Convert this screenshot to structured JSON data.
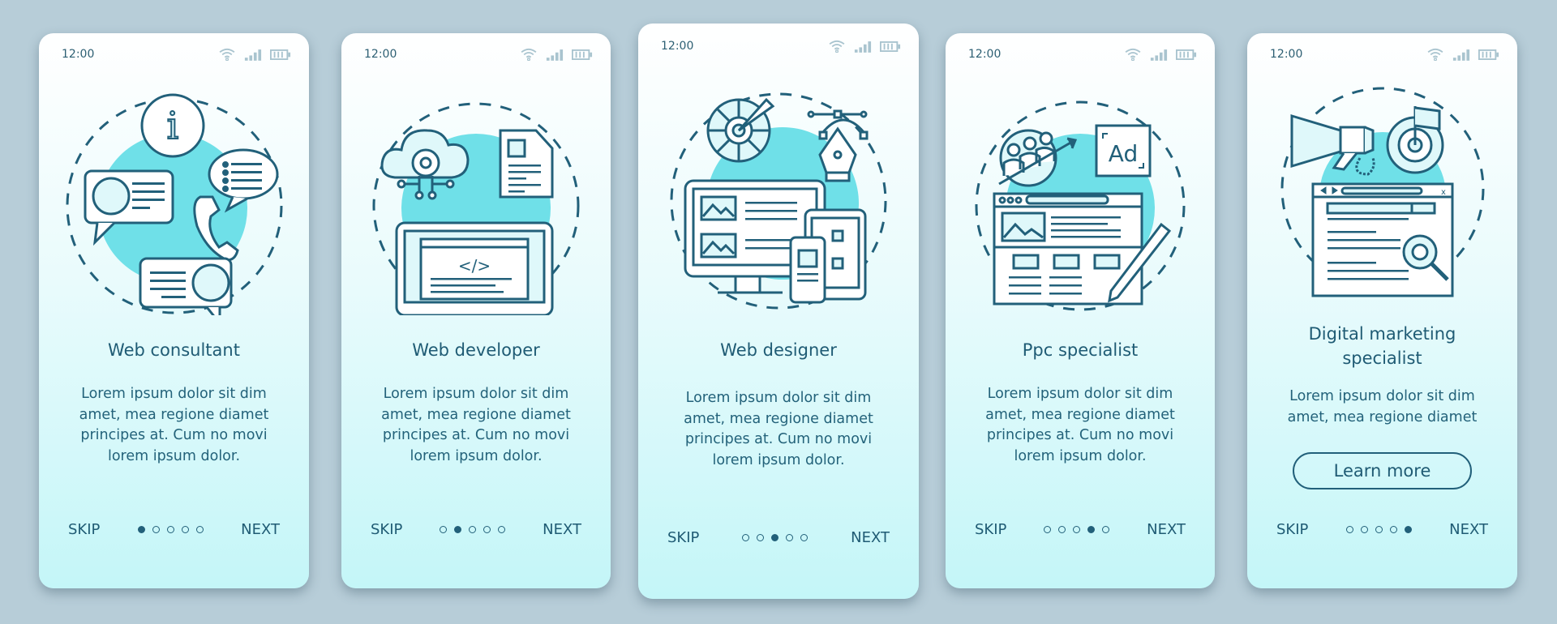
{
  "status_bar": {
    "time": "12:00"
  },
  "colors": {
    "accent": "#22607a",
    "blob": "#6fe0e8",
    "background": "#b7cdd8",
    "status_icons": "#a9c4cf"
  },
  "cards": [
    {
      "title": "Web consultant",
      "body": [
        "Lorem ipsum dolor sit dim",
        "amet, mea regione diamet",
        "principes at. Cum no movi",
        "lorem ipsum dolor."
      ],
      "illustration": "web-consultant-illustration",
      "skip": "SKIP",
      "next": "NEXT",
      "page": 1,
      "total_pages": 5
    },
    {
      "title": "Web developer",
      "body": [
        "Lorem ipsum dolor sit dim",
        "amet, mea regione diamet",
        "principes at. Cum no movi",
        "lorem ipsum dolor."
      ],
      "illustration": "web-developer-illustration",
      "skip": "SKIP",
      "next": "NEXT",
      "page": 2,
      "total_pages": 5
    },
    {
      "title": "Web designer",
      "body": [
        "Lorem ipsum dolor sit dim",
        "amet, mea regione diamet",
        "principes at. Cum no movi",
        "lorem ipsum dolor."
      ],
      "illustration": "web-designer-illustration",
      "skip": "SKIP",
      "next": "NEXT",
      "page": 3,
      "total_pages": 5
    },
    {
      "title": "Ppc specialist",
      "body": [
        "Lorem ipsum dolor sit dim",
        "amet, mea regione diamet",
        "principes at. Cum no movi",
        "lorem ipsum dolor."
      ],
      "illustration": "ppc-specialist-illustration",
      "ad_label": "Ad",
      "skip": "SKIP",
      "next": "NEXT",
      "page": 4,
      "total_pages": 5
    },
    {
      "title_lines": [
        "Digital marketing",
        "specialist"
      ],
      "body": [
        "Lorem ipsum dolor sit dim",
        "amet, mea regione diamet"
      ],
      "button": "Learn more",
      "illustration": "digital-marketing-illustration",
      "skip": "SKIP",
      "next": "NEXT",
      "page": 5,
      "total_pages": 5
    }
  ]
}
